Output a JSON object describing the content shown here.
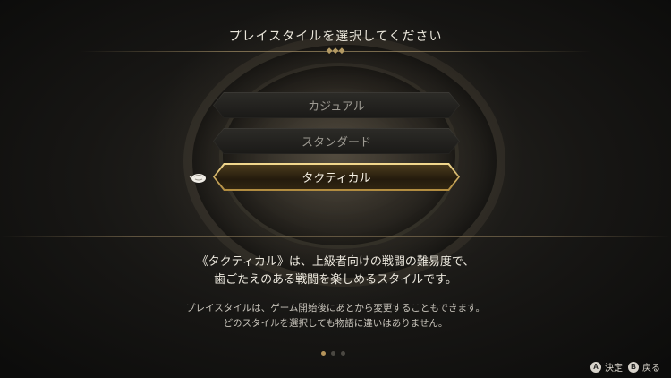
{
  "screen": {
    "title": "プレイスタイルを選択してください"
  },
  "options": [
    {
      "label": "カジュアル",
      "selected": false
    },
    {
      "label": "スタンダード",
      "selected": false
    },
    {
      "label": "タクティカル",
      "selected": true
    }
  ],
  "description": {
    "line1": "《タクティカル》は、上級者向けの戦闘の難易度で、",
    "line2": "歯ごたえのある戦闘を楽しめるスタイルです。"
  },
  "note": {
    "line1": "プレイスタイルは、ゲーム開始後にあとから変更することもできます。",
    "line2": "どのスタイルを選択しても物語に違いはありません。"
  },
  "pagination": {
    "total": 3,
    "current": 1
  },
  "controls": {
    "confirm": {
      "glyph": "A",
      "label": "決定"
    },
    "back": {
      "glyph": "B",
      "label": "戻る"
    }
  },
  "colors": {
    "accent_gold": "#d9b76a",
    "text": "#ece8de",
    "background": "#171614"
  }
}
